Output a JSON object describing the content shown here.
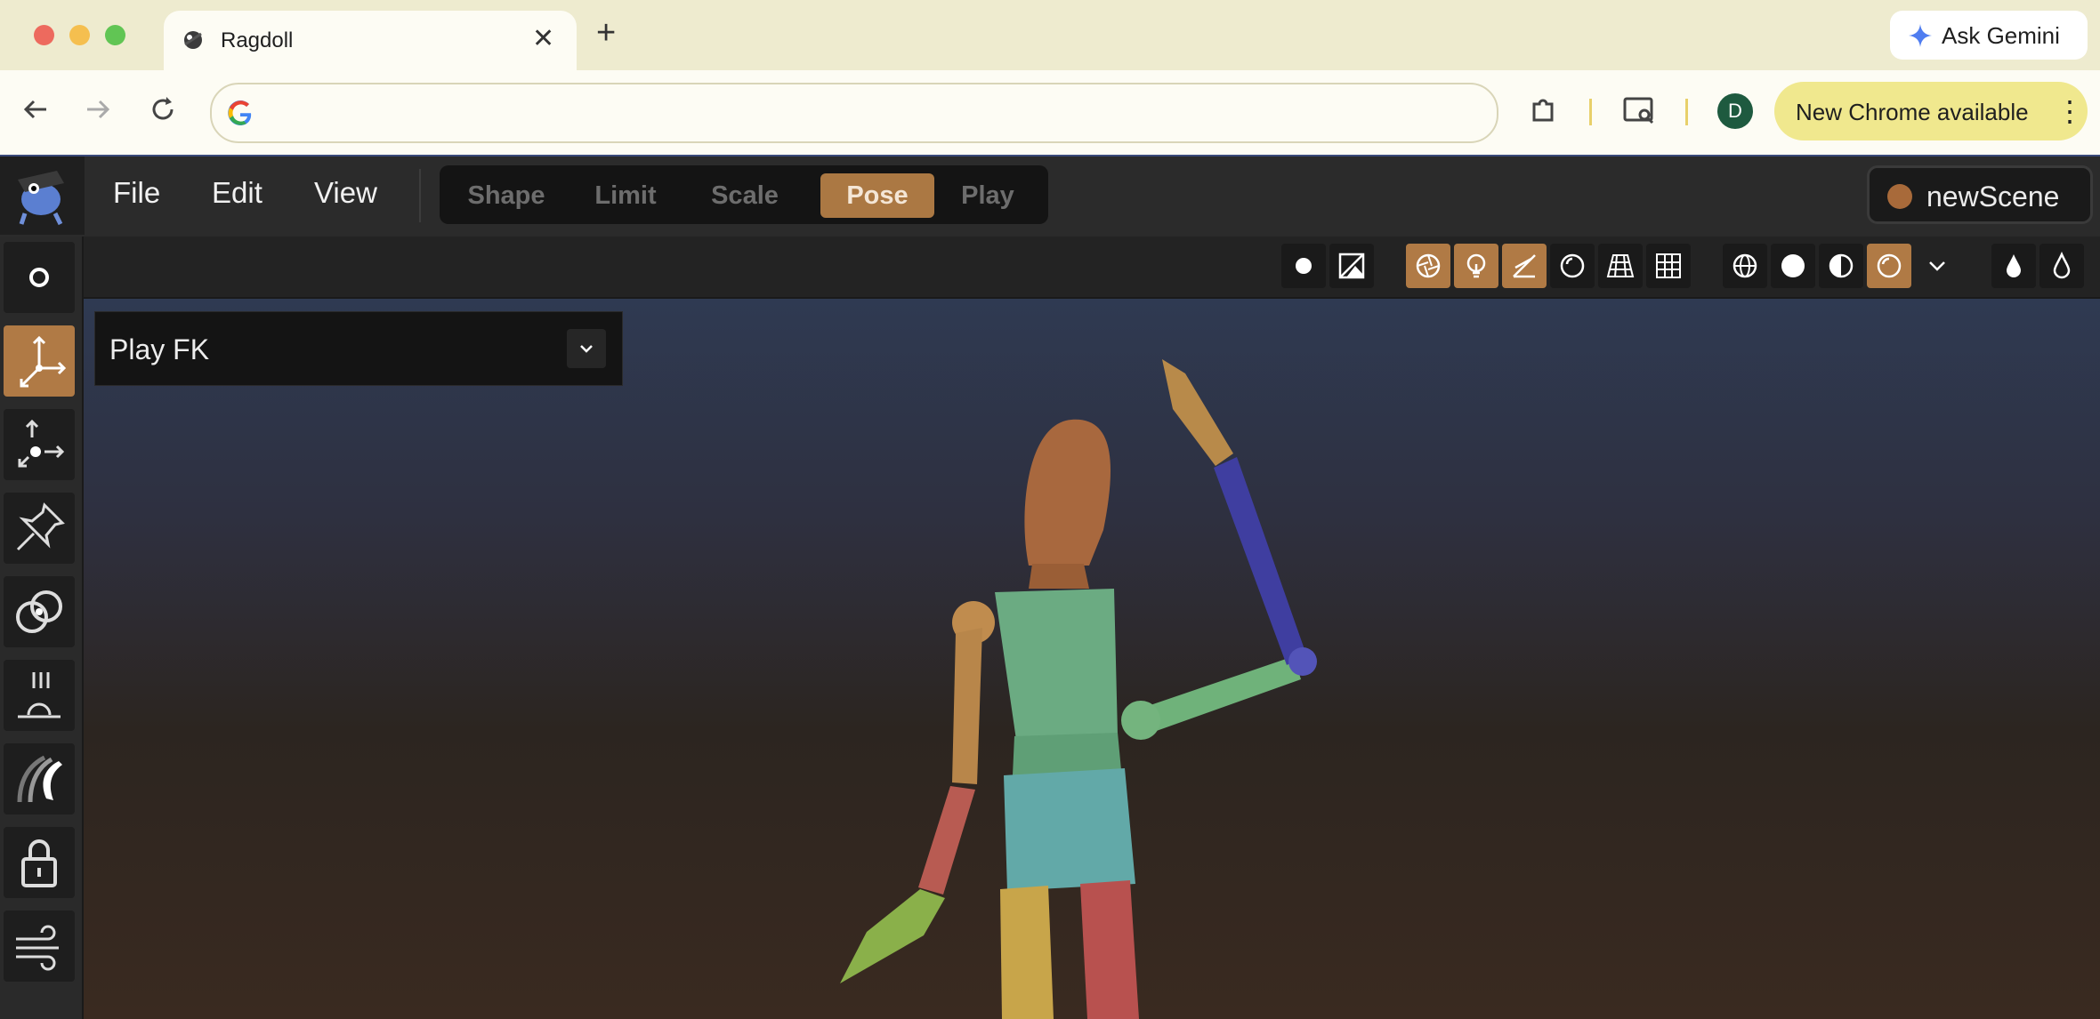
{
  "browser": {
    "tab_title": "Ragdoll",
    "tab_close": "✕",
    "new_tab": "+",
    "gemini_label": "Ask Gemini",
    "avatar_initial": "D",
    "update_label": "New Chrome available",
    "menu_dots": "⋮",
    "address_value": ""
  },
  "app": {
    "menu": {
      "file": "File",
      "edit": "Edit",
      "view": "View"
    },
    "modes": [
      {
        "label": "Shape",
        "active": false
      },
      {
        "label": "Limit",
        "active": false
      },
      {
        "label": "Scale",
        "active": false
      },
      {
        "label": "Pose",
        "active": true
      },
      {
        "label": "Play",
        "active": false
      }
    ],
    "scene_name": "newScene",
    "accent_color": "#b07a45",
    "playback_mode": "Play FK"
  },
  "tools": [
    {
      "icon": "circle-icon",
      "active": false
    },
    {
      "icon": "move-axes-icon",
      "active": true
    },
    {
      "icon": "move-pivot-icon",
      "active": false
    },
    {
      "icon": "pin-icon",
      "active": false
    },
    {
      "icon": "link-icon",
      "active": false
    },
    {
      "icon": "ground-icon",
      "active": false
    },
    {
      "icon": "wave-icon",
      "active": false
    },
    {
      "icon": "lock-icon",
      "active": false
    },
    {
      "icon": "wind-icon",
      "active": false
    }
  ],
  "viewport_buttons": [
    {
      "icon": "dot-icon",
      "on": false
    },
    {
      "icon": "image-icon",
      "on": false
    },
    {
      "icon": "aperture-icon",
      "on": true
    },
    {
      "icon": "bulb-icon",
      "on": true
    },
    {
      "icon": "pen-icon",
      "on": true
    },
    {
      "icon": "sphere-outline-icon",
      "on": false
    },
    {
      "icon": "floor-grid-icon",
      "on": false
    },
    {
      "icon": "grid-icon",
      "on": false
    },
    {
      "icon": "globe-icon",
      "on": false
    },
    {
      "icon": "solid-sphere-icon",
      "on": false
    },
    {
      "icon": "shaded-sphere-icon",
      "on": false
    },
    {
      "icon": "gloss-sphere-icon",
      "on": true
    },
    {
      "icon": "chevron-down-icon",
      "on": false
    },
    {
      "icon": "drop-filled-icon",
      "on": false
    },
    {
      "icon": "drop-outline-icon",
      "on": false
    }
  ]
}
